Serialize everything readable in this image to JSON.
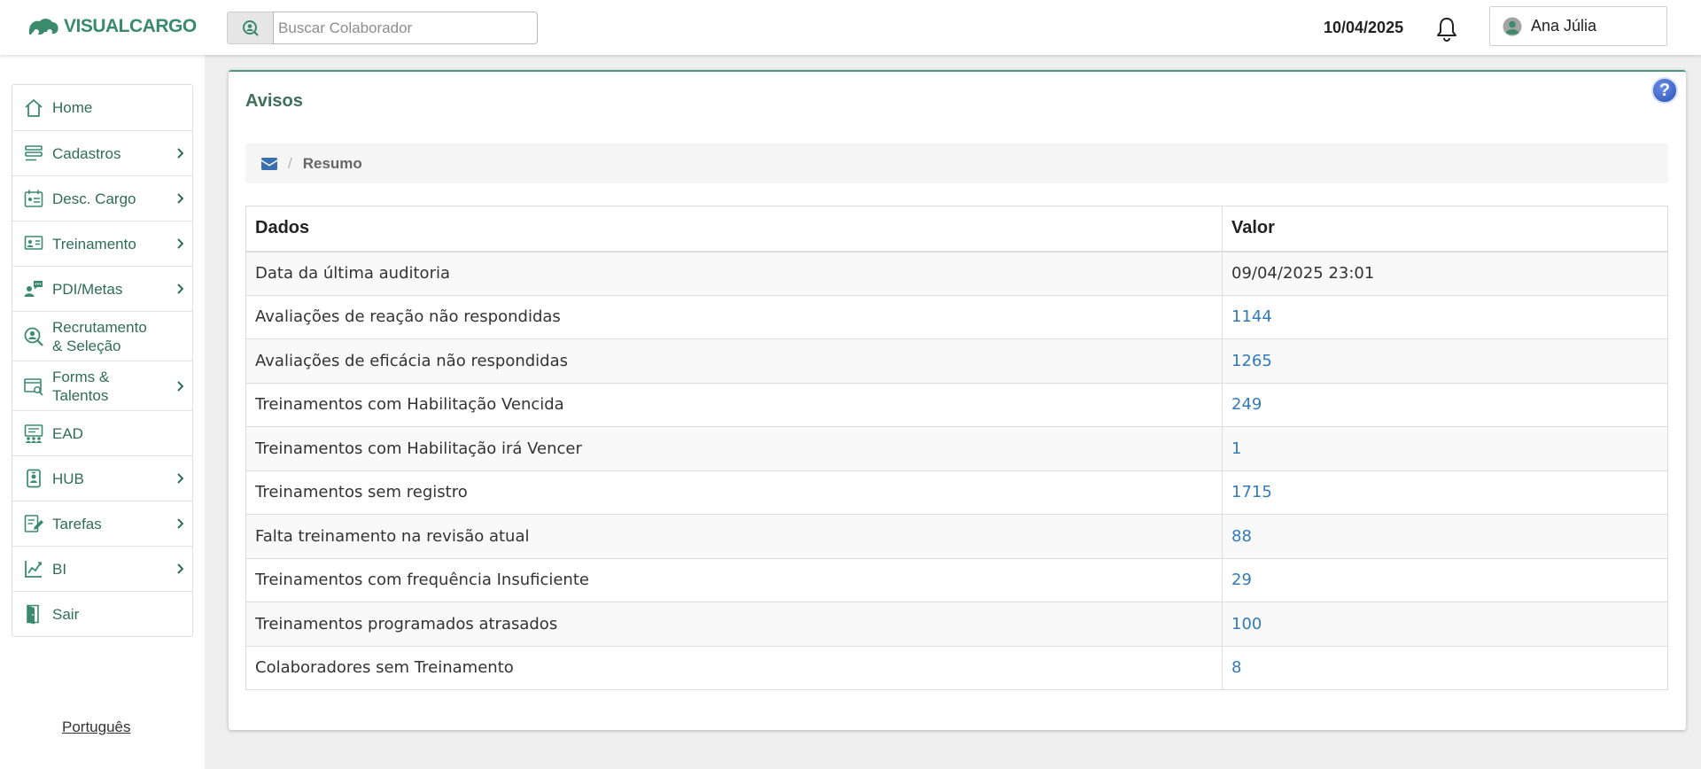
{
  "app": {
    "logo_text": "VISUALCARGO",
    "brand_color": "#3a8a6e"
  },
  "header": {
    "search_placeholder": "Buscar Colaborador",
    "date": "10/04/2025",
    "user_name": "Ana Júlia"
  },
  "sidebar": {
    "items": [
      {
        "label": "Home",
        "icon": "home-icon",
        "has_submenu": false
      },
      {
        "label": "Cadastros",
        "icon": "list-icon",
        "has_submenu": true
      },
      {
        "label": "Desc. Cargo",
        "icon": "calendar-id-icon",
        "has_submenu": true
      },
      {
        "label": "Treinamento",
        "icon": "training-icon",
        "has_submenu": true
      },
      {
        "label": "PDI/Metas",
        "icon": "chat-person-icon",
        "has_submenu": true
      },
      {
        "label": "Recrutamento & Seleção",
        "icon": "person-search-icon",
        "has_submenu": false
      },
      {
        "label": "Forms & Talentos",
        "icon": "form-search-icon",
        "has_submenu": true
      },
      {
        "label": "EAD",
        "icon": "classroom-icon",
        "has_submenu": false
      },
      {
        "label": "HUB",
        "icon": "badge-icon",
        "has_submenu": true
      },
      {
        "label": "Tarefas",
        "icon": "task-edit-icon",
        "has_submenu": true
      },
      {
        "label": "BI",
        "icon": "chart-icon",
        "has_submenu": true
      },
      {
        "label": "Sair",
        "icon": "exit-door-icon",
        "has_submenu": false
      }
    ],
    "language": "Português"
  },
  "main": {
    "title": "Avisos",
    "breadcrumb": {
      "icon": "envelope-icon",
      "label": "Resumo"
    },
    "table": {
      "headers": [
        "Dados",
        "Valor"
      ],
      "rows": [
        {
          "label": "Data da última auditoria",
          "value": "09/04/2025 23:01",
          "link": false
        },
        {
          "label": "Avaliações de reação não respondidas",
          "value": "1144",
          "link": true
        },
        {
          "label": "Avaliações de eficácia não respondidas",
          "value": "1265",
          "link": true
        },
        {
          "label": "Treinamentos com Habilitação Vencida",
          "value": "249",
          "link": true
        },
        {
          "label": "Treinamentos com Habilitação irá Vencer",
          "value": "1",
          "link": true
        },
        {
          "label": "Treinamentos sem registro",
          "value": "1715",
          "link": true
        },
        {
          "label": "Falta treinamento na revisão atual",
          "value": "88",
          "link": true
        },
        {
          "label": "Treinamentos com frequência Insuficiente",
          "value": "29",
          "link": true
        },
        {
          "label": "Treinamentos programados atrasados",
          "value": "100",
          "link": true
        },
        {
          "label": "Colaboradores sem Treinamento",
          "value": "8",
          "link": true
        }
      ]
    }
  }
}
